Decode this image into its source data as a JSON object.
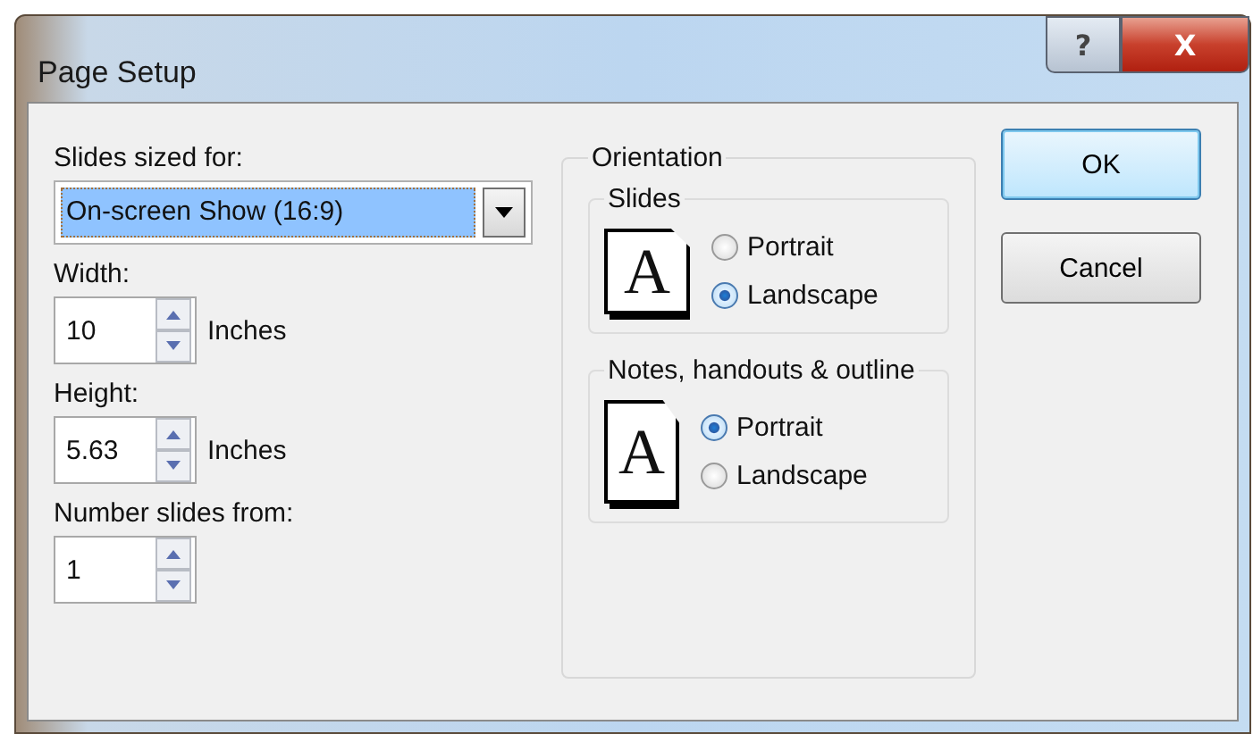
{
  "window": {
    "title": "Page Setup",
    "help": "?",
    "close": "X"
  },
  "size": {
    "label": "Slides sized for:",
    "value": "On-screen Show (16:9)",
    "highlighted": true
  },
  "spinners": [
    {
      "label": "Width:",
      "value": "10",
      "unit": "Inches"
    },
    {
      "label": "Height:",
      "value": "5.63",
      "unit": "Inches"
    },
    {
      "label": "Number slides from:",
      "value": "1"
    }
  ],
  "orientation": {
    "title": "Orientation",
    "groups": [
      {
        "title": "Slides",
        "icon_letter": "A",
        "options": [
          {
            "label": "Portrait",
            "selected": false
          },
          {
            "label": "Landscape",
            "selected": true
          }
        ]
      },
      {
        "title": "Notes, handouts & outline",
        "icon_letter": "A",
        "options": [
          {
            "label": "Portrait",
            "selected": true
          },
          {
            "label": "Landscape",
            "selected": false
          }
        ]
      }
    ]
  },
  "buttons": [
    {
      "label": "OK",
      "default": true
    },
    {
      "label": "Cancel",
      "default": false
    }
  ]
}
